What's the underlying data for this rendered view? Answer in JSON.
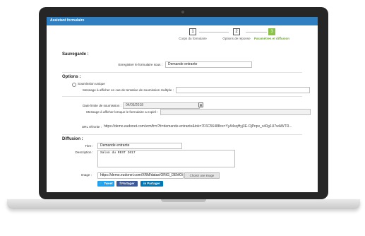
{
  "window": {
    "title": "Assistant formulaire"
  },
  "steps": [
    {
      "num": "1",
      "label": "Corps du formulaire",
      "active": false
    },
    {
      "num": "2",
      "label": "Options de réponse",
      "active": false
    },
    {
      "num": "3",
      "label": "Paramètres et diffusion",
      "active": true
    }
  ],
  "sauvegarde": {
    "heading": "Sauvegarde :",
    "save_label": "Enregistrer le formulaire sous :",
    "save_value": "Demande entrante"
  },
  "options": {
    "heading": "Options :",
    "unique_label": "Soumission unique",
    "retry_msg_label": "Message à afficher en cas de tentative de soumission multiple :",
    "retry_msg_value": "",
    "date_label": "Date limite de soumission :",
    "date_value": "04/05/2018",
    "expired_msg_label": "Message à afficher lorsque le formulaire a expiré :",
    "expired_msg_value": ""
  },
  "url": {
    "label": "URL réécrite :",
    "value": "https://demo.eudonet.com/xrm/frm?tt=demande-entrante&tok=7F6C56488cs=YyA4sqHyj3E-OjPnpx_o40g1U7wAWTR..."
  },
  "diffusion": {
    "heading": "Diffusion :",
    "title_label": "Titre :",
    "title_value": "Demande entrante",
    "desc_label": "Description :",
    "desc_value": "Salon du REST 2017",
    "image_label": "Image :",
    "image_value": "https://demo.eudonet.com/XRM/datas/ORIG_DEMO/",
    "image_button": "Choisir une image"
  },
  "share": [
    {
      "icon": "twitter-icon",
      "glyph": "🐦",
      "label": "Tweet",
      "color": "#1da1f2"
    },
    {
      "icon": "facebook-icon",
      "glyph": "f",
      "label": "Partager",
      "color": "#3b5998"
    },
    {
      "icon": "linkedin-icon",
      "glyph": "in",
      "label": "Partager",
      "color": "#0077b5"
    }
  ],
  "colors": {
    "accent": "#2f7fc1",
    "step_active": "#8bc34a"
  }
}
